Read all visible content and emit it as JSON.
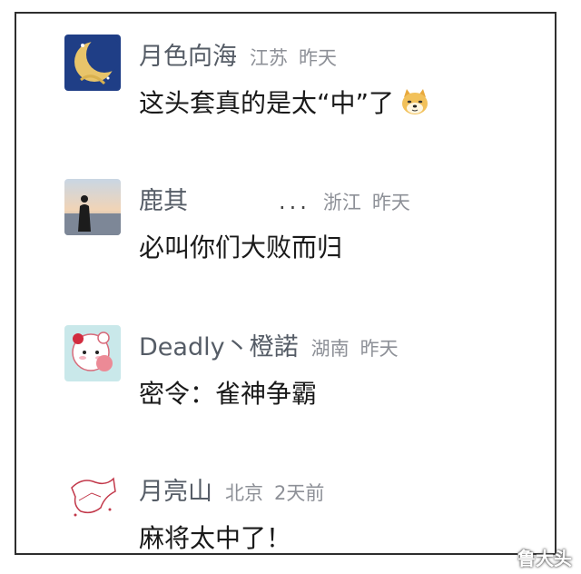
{
  "comments": [
    {
      "name": "月色向海",
      "location": "江苏",
      "time": "昨天",
      "text": "这头套真的是太“中”了",
      "emoji": "doge-emoji"
    },
    {
      "name": "鹿其",
      "ellipsis": "...",
      "location": "浙江",
      "time": "昨天",
      "text": "必叫你们大败而归"
    },
    {
      "name": "Deadly丶橙諾",
      "location": "湖南",
      "time": "昨天",
      "text": "密令：雀神争霸"
    },
    {
      "name": "月亮山",
      "location": "北京",
      "time": "2天前",
      "text": "麻将太中了！"
    }
  ],
  "watermark": "鲁大头",
  "colors": {
    "name": "#555c66",
    "meta": "#8d9097",
    "text": "#1a1a1a",
    "border": "#2e2e2e"
  }
}
